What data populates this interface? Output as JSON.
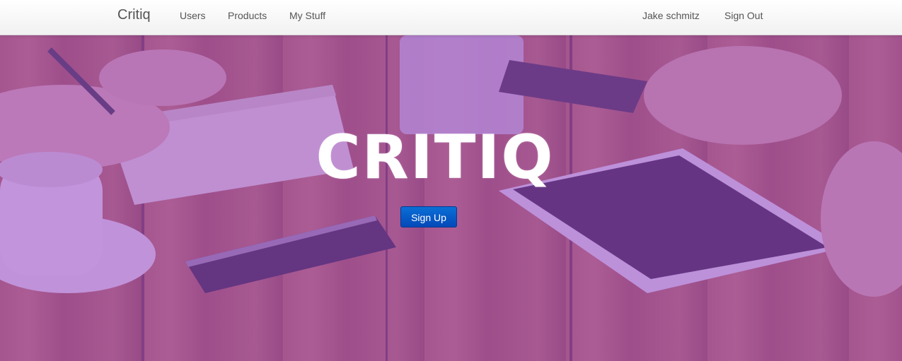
{
  "navbar": {
    "brand": "Critiq",
    "left_links": [
      {
        "label": "Users"
      },
      {
        "label": "Products"
      },
      {
        "label": "My Stuff"
      }
    ],
    "right_links": [
      {
        "label": "Jake schmitz"
      },
      {
        "label": "Sign Out"
      }
    ]
  },
  "hero": {
    "logo_text": "CRITIQ",
    "signup_label": "Sign Up",
    "overlay_color": "#9646c8",
    "button_color": "#0a5fd0"
  }
}
